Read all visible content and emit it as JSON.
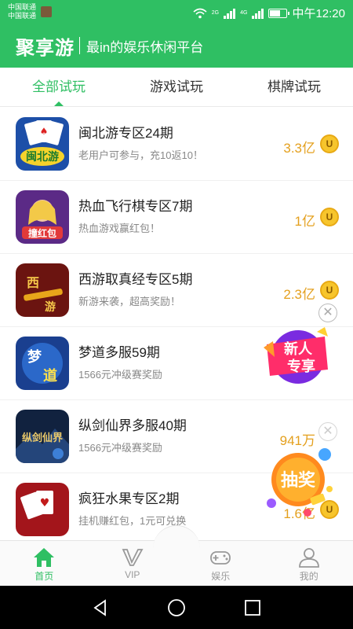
{
  "status_bar": {
    "carrier_1": "中国联通",
    "carrier_2": "中国联通",
    "network_1": "2G",
    "network_2": "4G",
    "time": "中午12:20",
    "battery_level": 0.7
  },
  "header": {
    "title": "聚享游",
    "slogan": "最in的娱乐休闲平台",
    "color": "#2fbf63"
  },
  "tabs": [
    {
      "label": "全部试玩",
      "active": true
    },
    {
      "label": "游戏试玩",
      "active": false
    },
    {
      "label": "棋牌试玩",
      "active": false
    }
  ],
  "games": [
    {
      "name": "闽北游专区24期",
      "desc": "老用户可参与，充10返10！",
      "reward": "3.3亿",
      "icon": "mahjong-cards-icon",
      "coin": "U"
    },
    {
      "name": "热血飞行棋专区7期",
      "desc": "热血游戏赢红包！",
      "reward": "1亿",
      "icon": "ludo-girl-icon",
      "coin": "U"
    },
    {
      "name": "西游取真经专区5期",
      "desc": "新游来袭，超高奖励！",
      "reward": "2.3亿",
      "icon": "xiyou-staff-icon",
      "coin": "U"
    },
    {
      "name": "梦道多服59期",
      "desc": "1566元冲级赛奖励",
      "reward": "",
      "icon": "mengdao-icon",
      "coin": "U"
    },
    {
      "name": "纵剑仙界多服40期",
      "desc": "1566元冲级赛奖励",
      "reward": "941万",
      "icon": "sword-fairy-icon",
      "coin": "U"
    },
    {
      "name": "疯狂水果专区2期",
      "desc": "挂机赚红包，1元可兑换",
      "reward": "1.6亿",
      "icon": "poker-cards-icon",
      "coin": "U"
    }
  ],
  "floating": {
    "new_user_label_1": "新人",
    "new_user_label_2": "专享",
    "lottery_label": "抽奖",
    "close_symbol": "✕"
  },
  "bottom_nav": [
    {
      "label": "首页",
      "icon": "home-icon",
      "active": true
    },
    {
      "label": "VIP",
      "icon": "vip-icon",
      "active": false
    },
    {
      "label": "娱乐",
      "icon": "gamepad-icon",
      "active": false
    },
    {
      "label": "我的",
      "icon": "user-icon",
      "active": false
    }
  ]
}
